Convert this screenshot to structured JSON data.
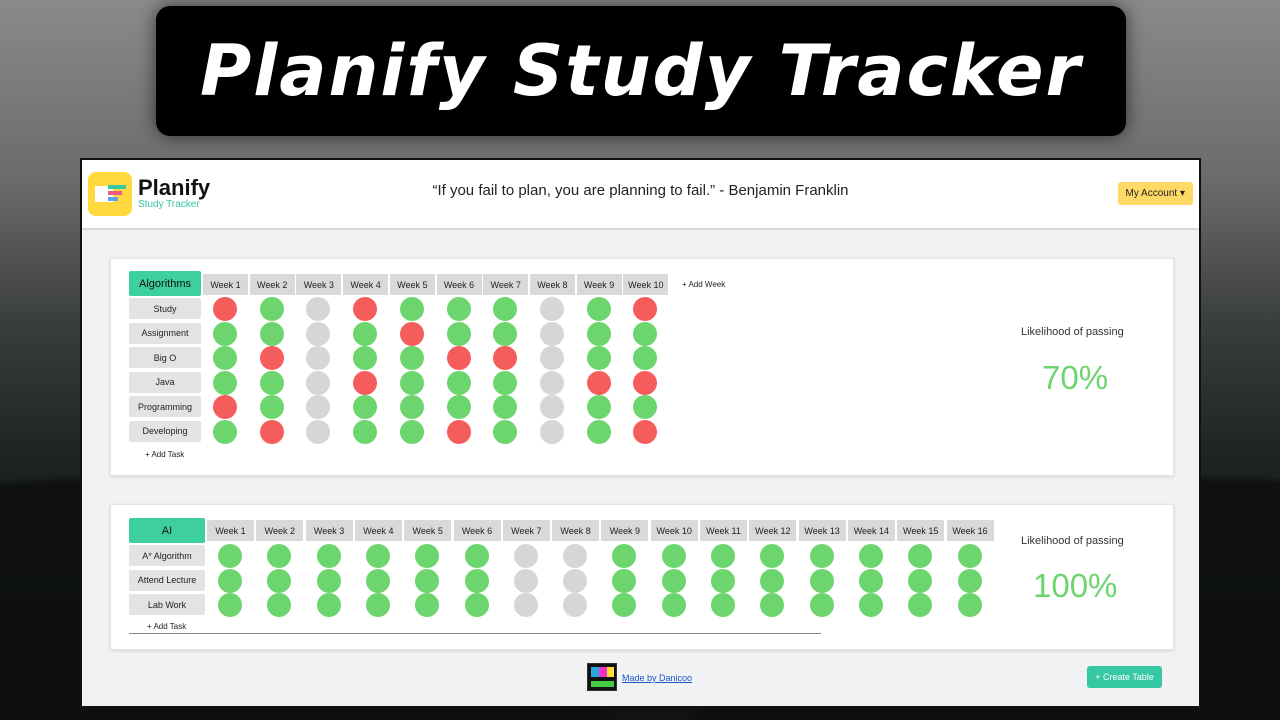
{
  "banner": {
    "title": "Planify Study Tracker"
  },
  "navbar": {
    "brand_name": "Planify",
    "brand_sub": "Study Tracker",
    "quote": "“If you fail to plan, you are planning to fail.” - Benjamin Franklin",
    "account_label": "My Account ▾"
  },
  "tables": [
    {
      "subject": "Algorithms",
      "weeks": [
        "Week 1",
        "Week 2",
        "Week 3",
        "Week 4",
        "Week 5",
        "Week 6",
        "Week 7",
        "Week 8",
        "Week 9",
        "Week 10"
      ],
      "add_week": "+ Add Week",
      "tasks": [
        {
          "name": "Study",
          "status": [
            "r",
            "g",
            "x",
            "r",
            "g",
            "g",
            "g",
            "x",
            "g",
            "r"
          ]
        },
        {
          "name": "Assignment",
          "status": [
            "g",
            "g",
            "x",
            "g",
            "r",
            "g",
            "g",
            "x",
            "g",
            "g"
          ]
        },
        {
          "name": "Big O",
          "status": [
            "g",
            "r",
            "x",
            "g",
            "g",
            "r",
            "r",
            "x",
            "g",
            "g"
          ]
        },
        {
          "name": "Java",
          "status": [
            "g",
            "g",
            "x",
            "r",
            "g",
            "g",
            "g",
            "x",
            "r",
            "r"
          ]
        },
        {
          "name": "Programming",
          "status": [
            "r",
            "g",
            "x",
            "g",
            "g",
            "g",
            "g",
            "x",
            "g",
            "g"
          ]
        },
        {
          "name": "Developing",
          "status": [
            "g",
            "r",
            "x",
            "g",
            "g",
            "r",
            "g",
            "x",
            "g",
            "r"
          ]
        }
      ],
      "add_task": "+ Add Task",
      "likelihood_label": "Likelihood of passing",
      "likelihood_value": "70%"
    },
    {
      "subject": "AI",
      "weeks": [
        "Week 1",
        "Week 2",
        "Week 3",
        "Week 4",
        "Week 5",
        "Week 6",
        "Week 7",
        "Week 8",
        "Week 9",
        "Week 10",
        "Week 11",
        "Week 12",
        "Week 13",
        "Week 14",
        "Week 15",
        "Week 16"
      ],
      "tasks": [
        {
          "name": "A* Algorithm",
          "status": [
            "g",
            "g",
            "g",
            "g",
            "g",
            "g",
            "x",
            "x",
            "g",
            "g",
            "g",
            "g",
            "g",
            "g",
            "g",
            "g"
          ]
        },
        {
          "name": "Attend Lecture",
          "status": [
            "g",
            "g",
            "g",
            "g",
            "g",
            "g",
            "x",
            "x",
            "g",
            "g",
            "g",
            "g",
            "g",
            "g",
            "g",
            "g"
          ]
        },
        {
          "name": "Lab Work",
          "status": [
            "g",
            "g",
            "g",
            "g",
            "g",
            "g",
            "x",
            "x",
            "g",
            "g",
            "g",
            "g",
            "g",
            "g",
            "g",
            "g"
          ]
        }
      ],
      "add_task": "+ Add Task",
      "likelihood_label": "Likelihood of passing",
      "likelihood_value": "100%"
    }
  ],
  "footer": {
    "made_by": "Made by Danicoo",
    "create_table": "+ Create Table"
  },
  "colors": {
    "green": "#6dd56d",
    "red": "#f55c5c",
    "grey": "#d6d6d6",
    "accent": "#3ecf9e",
    "yellow": "#ffd966"
  }
}
